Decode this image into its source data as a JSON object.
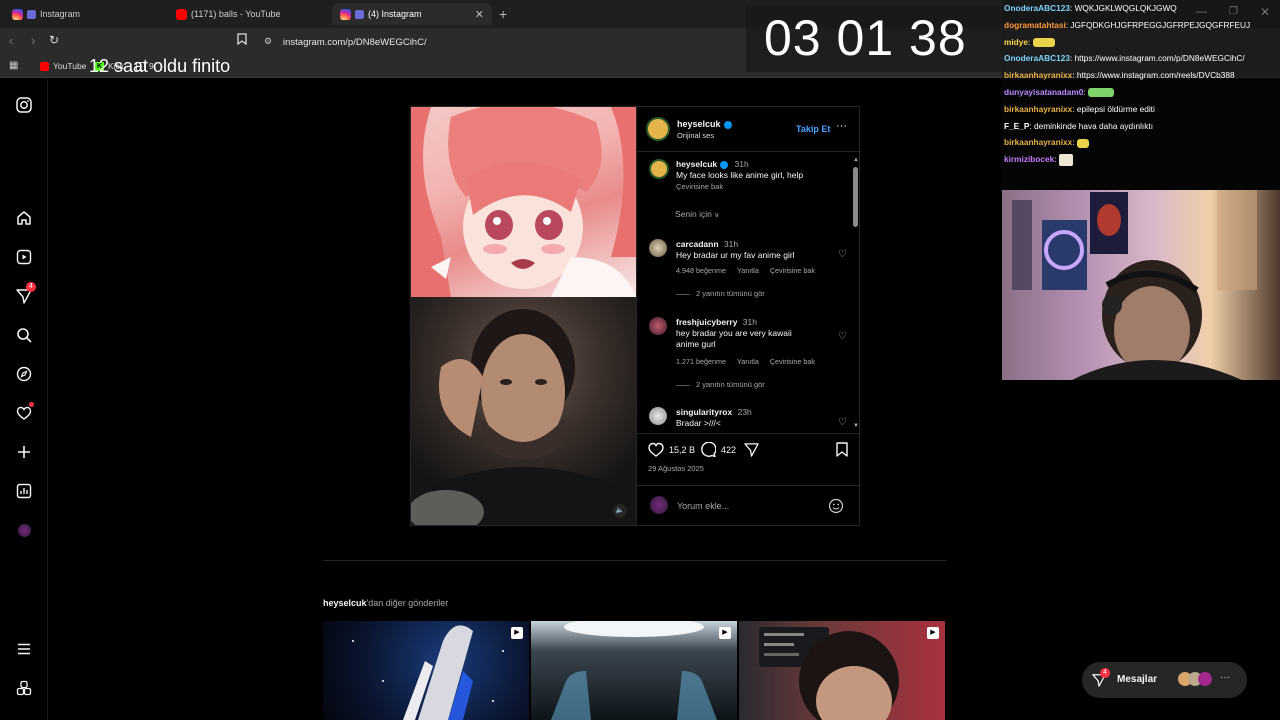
{
  "browser": {
    "tabs": [
      {
        "label": "Instagram",
        "icon": "instagram-icon"
      },
      {
        "label": "(1171) balls - YouTube",
        "icon": "youtube-icon"
      },
      {
        "label": "(4) Instagram",
        "icon": "instagram-icon"
      }
    ],
    "url": "instagram.com/p/DN8eWEGCihC/",
    "bookmarks": [
      {
        "label": "YouTube"
      },
      {
        "label": "Kick"
      },
      {
        "label": "9"
      }
    ]
  },
  "nav": {
    "notifications_badge": "4",
    "icons": [
      "instagram-icon",
      "home-icon",
      "reels-icon",
      "messages-icon",
      "search-icon",
      "explore-icon",
      "notifications-icon",
      "create-icon",
      "dashboard-icon",
      "profile-icon",
      "menu-icon",
      "also-from-meta-icon"
    ]
  },
  "post": {
    "username": "heyselcuk",
    "audio": "Orijinal ses",
    "follow_label": "Takip Et",
    "caption_time": "31h",
    "caption": "My face looks like anime girl, help",
    "caption_translate": "Çevirisine bak",
    "sort_label": "Senin için",
    "comments": [
      {
        "user": "carcadann",
        "time": "31h",
        "text": "Hey bradar ur my fav anime girl",
        "likes": "4.948 beğenme",
        "reply": "Yanıtla",
        "translate": "Çevirisine bak",
        "replies": "2 yanıtın tümünü gör"
      },
      {
        "user": "freshjuicyberry",
        "time": "31h",
        "text": "hey bradar you are very kawaii anime gurl",
        "likes": "1.271 beğenme",
        "reply": "Yanıtla",
        "translate": "Çevirisine bak",
        "replies": "2 yanıtın tümünü gör"
      },
      {
        "user": "singularityrox",
        "time": "23h",
        "text": "Bradar >///<"
      }
    ],
    "like_count": "15,2 B",
    "comment_count": "422",
    "date": "29 Ağustos 2025",
    "comment_placeholder": "Yorum ekle..."
  },
  "more_posts": {
    "title_user": "heyselcuk",
    "title_suffix": "'dan diğer gönderiler"
  },
  "messages_button": {
    "label": "Mesajlar",
    "badge": "4"
  },
  "stream_overlay": {
    "timer": "03 01 38",
    "timer_caption": "12 saat oldu finito",
    "chat": [
      {
        "user": "OnoderaABC123",
        "color": "#7fd3ff",
        "text": "WQKJGKLWQGLQKJGWQ"
      },
      {
        "user": "dogramatahtasi",
        "color": "#ff9a3c",
        "text": "JGFQDKGHJGFRPEGGJGFRPEJGQGFRFEUJ"
      },
      {
        "user": "midye",
        "color": "#ffd84a",
        "text": ""
      },
      {
        "user": "OnoderaABC123",
        "color": "#7fd3ff",
        "text": "https://www.instagram.com/p/DN8eWEGCihC/"
      },
      {
        "user": "birkaanhayranixx",
        "color": "#e8b04a",
        "text": "https://www.instagram.com/reels/DVCb388"
      },
      {
        "user": "dunyayisatanadam0",
        "color": "#b88cff",
        "text": ""
      },
      {
        "user": "birkaanhayranixx",
        "color": "#e8b04a",
        "text": "epilepsi öldürme editi"
      },
      {
        "user": "F_E_P",
        "color": "#ffffff",
        "text": "deminkinde hava daha aydınlıktı"
      },
      {
        "user": "birkaanhayranixx",
        "color": "#e8b04a",
        "text": ""
      },
      {
        "user": "kirmizibocek",
        "color": "#c77dff",
        "text": ""
      }
    ]
  }
}
